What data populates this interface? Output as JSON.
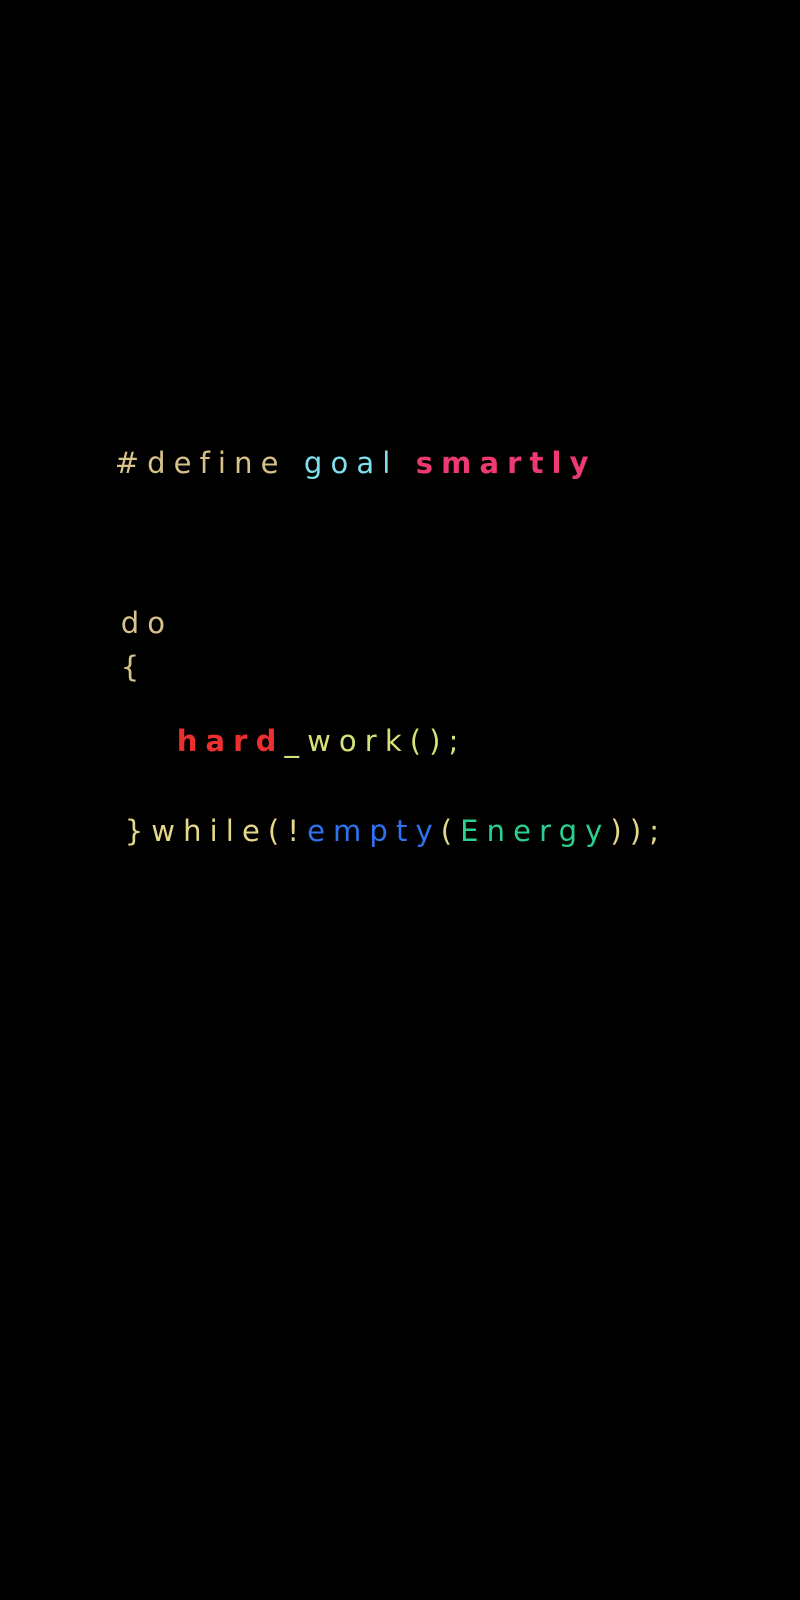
{
  "colors": {
    "background": "#000000",
    "keyword": "#d9c28a",
    "identifier_goal": "#7ee0ec",
    "value_smartly": "#ee3a72",
    "hard": "#ee2f2f",
    "work": "#d8e07a",
    "punct": "#e6d889",
    "empty": "#2f72ee",
    "energy": "#2ad08e"
  },
  "code": {
    "define_directive": "#define",
    "goal": "goal",
    "smartly": "smartly",
    "do_keyword": "do",
    "open_brace": "{",
    "hard": "hard",
    "work_call": "_work();",
    "while_prefix": "}while(!",
    "empty": "empty",
    "open_paren": "(",
    "energy": "Energy",
    "close": "));"
  }
}
